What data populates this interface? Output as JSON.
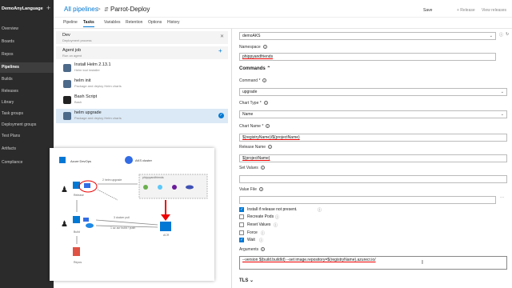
{
  "nav": {
    "project": "DemoAnyLanguage",
    "items": [
      {
        "label": "Overview",
        "active": false
      },
      {
        "label": "Boards",
        "active": false
      },
      {
        "label": "Repos",
        "active": false
      },
      {
        "label": "Pipelines",
        "active": true
      },
      {
        "label": "Builds",
        "active": false
      },
      {
        "label": "Releases",
        "active": false
      },
      {
        "label": "Library",
        "active": false
      },
      {
        "label": "Task groups",
        "active": false
      },
      {
        "label": "Deployment groups",
        "active": false
      },
      {
        "label": "Test Plans",
        "active": false
      },
      {
        "label": "Artifacts",
        "active": false
      },
      {
        "label": "Compliance",
        "active": false
      }
    ]
  },
  "header": {
    "breadcrumb": "All pipelines",
    "separator": ">",
    "pipeline_name": "Parrot-Deploy",
    "save": "Save",
    "release": "+ Release",
    "view_releases": "View releases"
  },
  "tabs": [
    "Pipeline",
    "Tasks",
    "Variables",
    "Retention",
    "Options",
    "History"
  ],
  "active_tab": "Tasks",
  "stage": {
    "title": "Dev",
    "subtitle": "Deployment process"
  },
  "job": {
    "title": "Agent job",
    "subtitle": "Run on agent"
  },
  "tasks": [
    {
      "title": "Install Helm 2.13.1",
      "subtitle": "Helm tool installer",
      "icon": "helm-icon",
      "selected": false
    },
    {
      "title": "helm init",
      "subtitle": "Package and deploy Helm charts",
      "icon": "helm-icon",
      "selected": false
    },
    {
      "title": "Bash Script",
      "subtitle": "Bash",
      "icon": "bash-icon",
      "selected": false
    },
    {
      "title": "helm upgrade",
      "subtitle": "Package and deploy Helm charts",
      "icon": "helm-icon",
      "selected": true
    }
  ],
  "diagram": {
    "azure_devops": "Azure DevOps",
    "aks": "AKS cluster",
    "namespace": "phippyandfriends",
    "helm_upgrade": "2 helm upgrade",
    "docker_pull": "3 docker pull",
    "docker_push": "1 az acr build / push",
    "release_label": "Release",
    "build_label": "Build",
    "repos_label": "Repos",
    "acr_label": "ACR"
  },
  "settings": {
    "cluster_value": "demoAKS",
    "namespace_label": "Namespace",
    "namespace_value": "phippyandfriends",
    "commands_section": "Commands",
    "command_label": "Command *",
    "command_value": "upgrade",
    "chart_type_label": "Chart Type *",
    "chart_type_value": "Name",
    "chart_name_label": "Chart Name *",
    "chart_name_value": "$(registryName)/$(projectName)",
    "release_name_label": "Release Name",
    "release_name_value": "$(projectName)",
    "set_values_label": "Set Values",
    "value_file_label": "Value File",
    "checkboxes": [
      {
        "label": "Install if release not present.",
        "checked": true
      },
      {
        "label": "Recreate Pods",
        "checked": false
      },
      {
        "label": "Reset Values",
        "checked": false
      },
      {
        "label": "Force",
        "checked": false
      },
      {
        "label": "Wait",
        "checked": true
      }
    ],
    "arguments_label": "Arguments",
    "arguments_value": "--version $(build.buildId) --set image.repository=$(registryName).azurecr.io/",
    "tls_section": "TLS"
  },
  "colors": {
    "accent": "#0078d4",
    "nav_bg": "#2b2b2b",
    "selected_task": "#dbe9f6"
  }
}
